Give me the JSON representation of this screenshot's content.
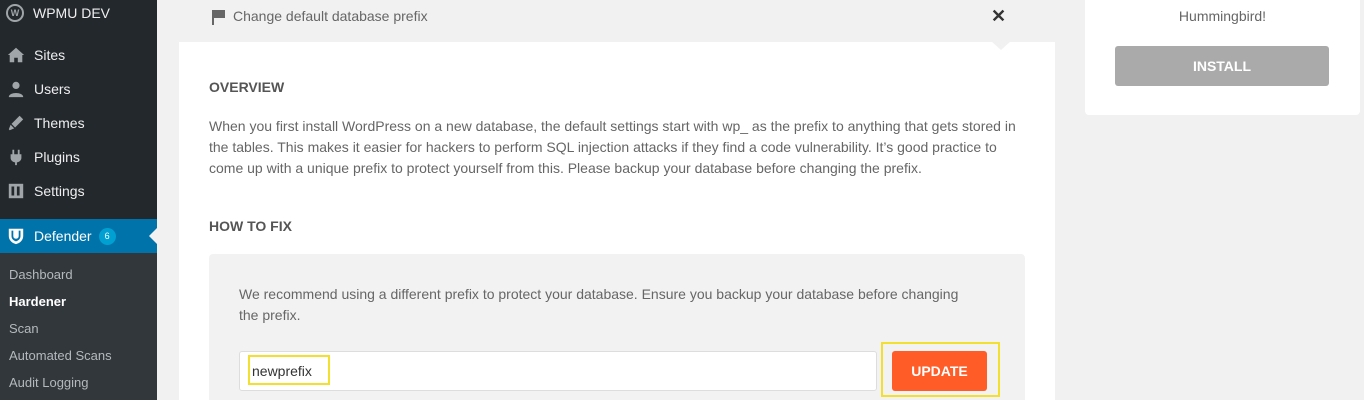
{
  "sidebar": {
    "site_name": "WPMU DEV",
    "items": [
      {
        "label": "Sites",
        "icon": "sites-icon"
      },
      {
        "label": "Users",
        "icon": "users-icon"
      },
      {
        "label": "Themes",
        "icon": "themes-icon"
      },
      {
        "label": "Plugins",
        "icon": "plugins-icon"
      },
      {
        "label": "Settings",
        "icon": "settings-icon"
      }
    ],
    "defender": {
      "label": "Defender",
      "badge": "6"
    },
    "submenu": [
      "Dashboard",
      "Hardener",
      "Scan",
      "Automated Scans",
      "Audit Logging"
    ],
    "current_submenu": "Hardener"
  },
  "issue": {
    "title": "Change default database prefix",
    "overview_heading": "OVERVIEW",
    "overview_text": "When you first install WordPress on a new database, the default settings start with wp_ as the prefix to anything that gets stored in the tables. This makes it easier for hackers to perform SQL injection attacks if they find a code vulnerability. It’s good practice to come up with a unique prefix to protect yourself from this. Please backup your database before changing the prefix.",
    "how_to_fix_heading": "HOW TO FIX",
    "fix_text": "We recommend using a different prefix to protect your database. Ensure you backup your database before changing the prefix.",
    "prefix_value": "newprefix",
    "update_label": "UPDATE"
  },
  "widget": {
    "text": "Hummingbird!",
    "install_label": "INSTALL"
  },
  "colors": {
    "sidebar_bg": "#23282d",
    "active_blue": "#0073aa",
    "update_orange": "#ff5c28",
    "highlight_yellow": "#f2df2f"
  }
}
